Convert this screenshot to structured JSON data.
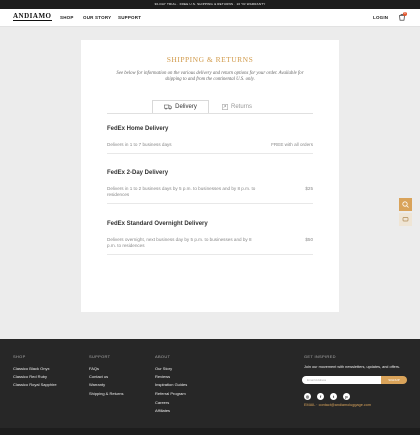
{
  "announcement": "30-DAY TRIAL · FREE U.S. SHIPPING & RETURNS · 10 YR WARRANTY",
  "nav": {
    "logo": "ANDIAMO",
    "links": [
      "SHOP",
      "OUR STORY",
      "SUPPORT"
    ],
    "login": "LOGIN",
    "cart_count": "0"
  },
  "page": {
    "title": "SHIPPING & RETURNS",
    "subtitle": "See below for information on the various delivery and return options for your order. Available for shipping to and from the continental U.S. only."
  },
  "tabs": [
    {
      "label": "Delivery",
      "icon": "truck-icon",
      "active": true
    },
    {
      "label": "Returns",
      "icon": "return-icon",
      "active": false
    }
  ],
  "options": [
    {
      "title": "FedEx Home Delivery",
      "desc": "Delivers in 1 to 7 business days",
      "price": "FREE with all orders"
    },
    {
      "title": "FedEx 2-Day Delivery",
      "desc": "Delivers in 1 to 2 business days by 5 p.m. to businesses and by 8 p.m. to residences",
      "price": "$25"
    },
    {
      "title": "FedEx Standard Overnight Delivery",
      "desc": "Delivers overnight, next business day by 5 p.m. to businesses and by 8 p.m. to residences",
      "price": "$50"
    }
  ],
  "footer": {
    "shop": {
      "heading": "SHOP",
      "links": [
        "Classico Black Onyx",
        "Classico Red Ruby",
        "Classico Royal Sapphire"
      ]
    },
    "support": {
      "heading": "SUPPORT",
      "links": [
        "FAQs",
        "Contact us",
        "Warranty",
        "Shipping & Returns"
      ]
    },
    "about": {
      "heading": "ABOUT",
      "links": [
        "Our Story",
        "Reviews",
        "Inspiration Guides",
        "Referral Program",
        "Careers",
        "Affiliates"
      ]
    },
    "inspired": {
      "heading": "GET INSPIRED",
      "text": "Join our movement with newsletters, updates, and offers.",
      "email_placeholder": "Email Address",
      "signup_label": "SIGNUP",
      "socials": [
        "instagram-icon",
        "facebook-icon",
        "twitter-icon",
        "pinterest-icon"
      ],
      "contact": "EMAIL · contact@andiamoluggage.com"
    }
  },
  "colors": {
    "accent": "#d9a35a",
    "title": "#d19a4a",
    "footer_bg": "#272727"
  }
}
